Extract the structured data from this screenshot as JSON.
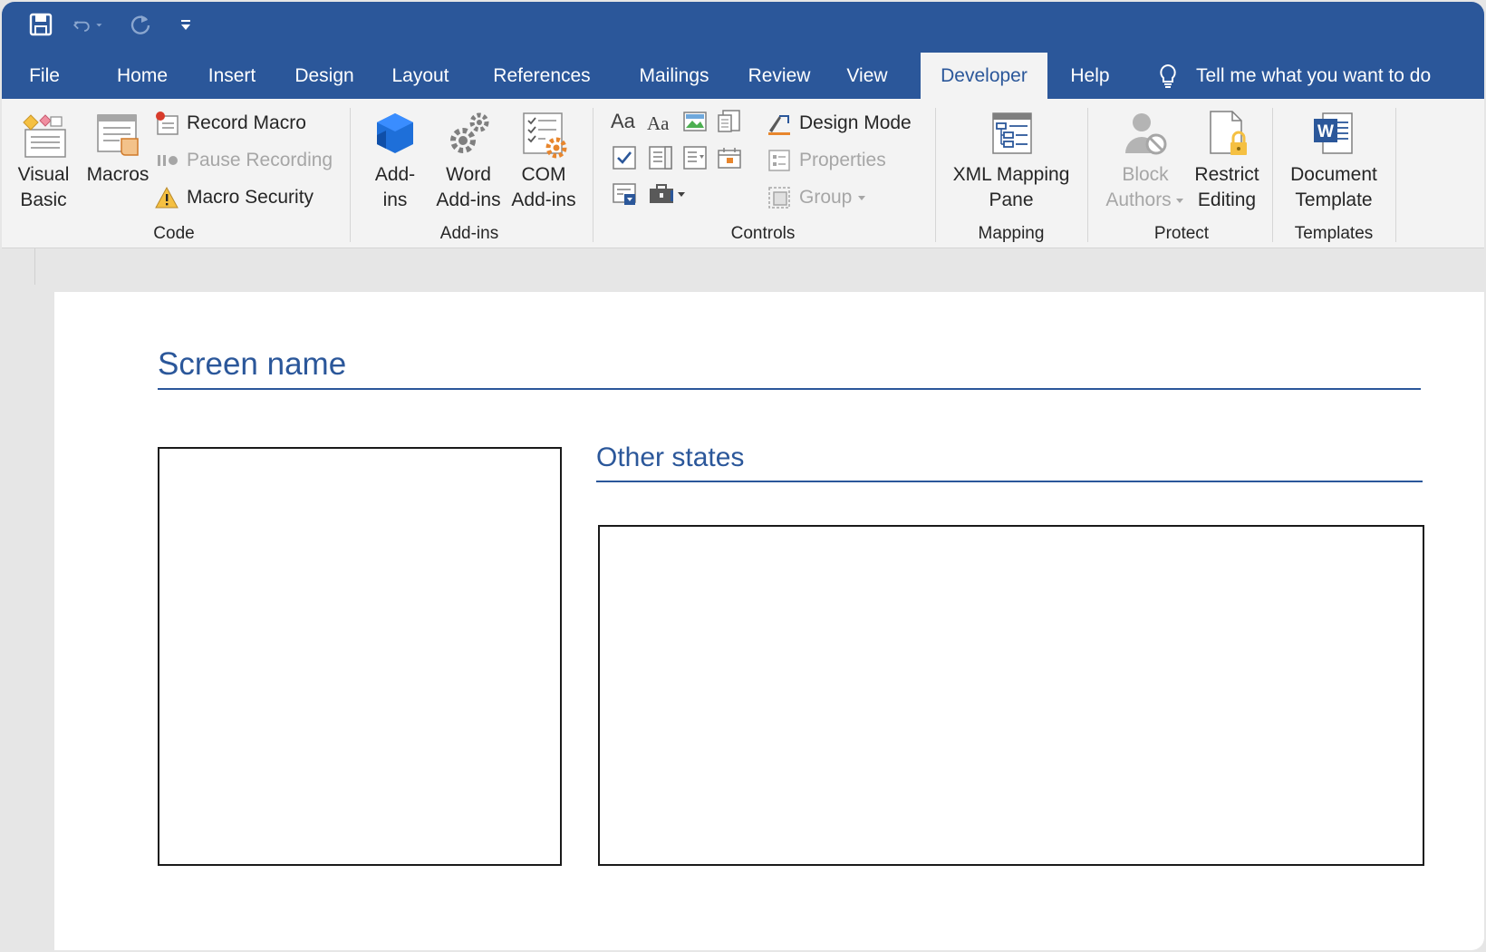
{
  "quick_access": {
    "save_icon": "save-icon",
    "undo_icon": "undo-icon",
    "redo_icon": "redo-icon",
    "customize_icon": "customize-qat-icon"
  },
  "tabs": [
    {
      "label": "File"
    },
    {
      "label": "Home"
    },
    {
      "label": "Insert"
    },
    {
      "label": "Design"
    },
    {
      "label": "Layout"
    },
    {
      "label": "References"
    },
    {
      "label": "Mailings"
    },
    {
      "label": "Review"
    },
    {
      "label": "View"
    },
    {
      "label": "Developer"
    },
    {
      "label": "Help"
    }
  ],
  "active_tab": "Developer",
  "tell_me": "Tell me what you want to do",
  "ribbon": {
    "code": {
      "label": "Code",
      "visual_basic": [
        "Visual",
        "Basic"
      ],
      "macros": "Macros",
      "record_macro": "Record Macro",
      "pause_recording": "Pause Recording",
      "macro_security": "Macro Security"
    },
    "addins": {
      "label": "Add-ins",
      "addins": [
        "Add-",
        "ins"
      ],
      "word_addins": [
        "Word",
        "Add-ins"
      ],
      "com_addins": [
        "COM",
        "Add-ins"
      ]
    },
    "controls": {
      "label": "Controls",
      "design_mode": "Design Mode",
      "properties": "Properties",
      "group": "Group",
      "rich_text": "Aa",
      "plain_text": "Aa"
    },
    "mapping": {
      "label": "Mapping",
      "xml_mapping": [
        "XML Mapping",
        "Pane"
      ]
    },
    "protect": {
      "label": "Protect",
      "block_authors": [
        "Block",
        "Authors"
      ],
      "restrict_editing": [
        "Restrict",
        "Editing"
      ]
    },
    "templates": {
      "label": "Templates",
      "document_template": [
        "Document",
        "Template"
      ]
    }
  },
  "document": {
    "heading": "Screen name",
    "subheading": "Other states"
  },
  "colors": {
    "brand": "#2b579a",
    "ribbon_bg": "#f3f3f3",
    "disabled": "#a6a6a6"
  }
}
